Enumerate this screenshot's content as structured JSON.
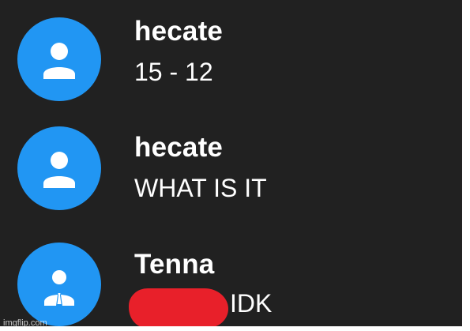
{
  "colors": {
    "background": "#212121",
    "avatar": "#2196f3",
    "text": "#ffffff",
    "redaction": "#e8202a"
  },
  "messages": [
    {
      "author": "hecate",
      "text": "15 - 12",
      "avatar_icon": "person-icon"
    },
    {
      "author": "hecate",
      "text": "WHAT IS IT",
      "avatar_icon": "person-icon"
    },
    {
      "author": "Tenna",
      "text": "IDK",
      "avatar_icon": "person-suit-icon"
    }
  ],
  "watermark": "imgflip.com"
}
